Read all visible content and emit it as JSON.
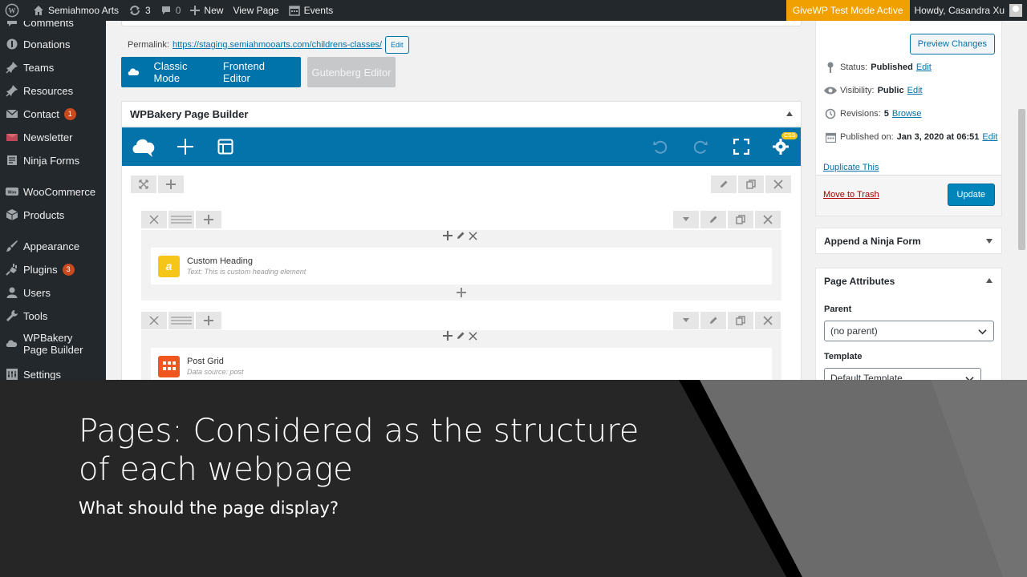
{
  "adminbar": {
    "site_name": "Semiahmoo Arts",
    "updates_count": "3",
    "comments_count": "0",
    "new_label": "New",
    "view_page_label": "View Page",
    "events_label": "Events",
    "givewp_label": "GiveWP Test Mode Active",
    "howdy_label": "Howdy, Casandra Xu"
  },
  "sidebar": {
    "items": [
      {
        "label": "Comments",
        "icon": "comment-icon"
      },
      {
        "label": "Donations",
        "icon": "donations-icon"
      },
      {
        "label": "Teams",
        "icon": "pin-icon"
      },
      {
        "label": "Resources",
        "icon": "pin-icon"
      },
      {
        "label": "Contact",
        "icon": "mail-icon",
        "badge": "1"
      },
      {
        "label": "Newsletter",
        "icon": "newsletter-icon"
      },
      {
        "label": "Ninja Forms",
        "icon": "forms-icon"
      },
      {
        "label": "WooCommerce",
        "icon": "woo-icon"
      },
      {
        "label": "Products",
        "icon": "products-icon"
      },
      {
        "label": "Appearance",
        "icon": "brush-icon"
      },
      {
        "label": "Plugins",
        "icon": "plugin-icon",
        "badge": "3"
      },
      {
        "label": "Users",
        "icon": "user-icon"
      },
      {
        "label": "Tools",
        "icon": "wrench-icon"
      },
      {
        "label": "WPBakery Page Builder",
        "icon": "wpbakery-icon"
      },
      {
        "label": "Settings",
        "icon": "settings-icon"
      }
    ]
  },
  "editor": {
    "permalink_label": "Permalink:",
    "permalink_url": "https://staging.semiahmooarts.com/childrens-classes/",
    "permalink_edit": "Edit",
    "classic_mode_label": "Classic Mode",
    "frontend_editor_label": "Frontend Editor",
    "gutenberg_label": "Gutenberg Editor",
    "wpb_title": "WPBakery Page Builder",
    "css_badge": "CSS",
    "elements": [
      {
        "name": "Custom Heading",
        "sub": "Text: This is custom heading element",
        "icon_glyph": "a",
        "color": "#f5c518"
      },
      {
        "name": "Post Grid",
        "sub": "Data source: post",
        "icon_glyph": "",
        "color": "#f0571f"
      }
    ]
  },
  "publish": {
    "preview_label": "Preview Changes",
    "status_label": "Status:",
    "status_value": "Published",
    "visibility_label": "Visibility:",
    "visibility_value": "Public",
    "revisions_label": "Revisions:",
    "revisions_value": "5",
    "browse_label": "Browse",
    "published_on_label": "Published on:",
    "published_on_value": "Jan 3, 2020 at 06:51",
    "edit_label": "Edit",
    "duplicate_label": "Duplicate This",
    "trash_label": "Move to Trash",
    "update_label": "Update"
  },
  "ninja": {
    "title": "Append a Ninja Form"
  },
  "page_attributes": {
    "title": "Page Attributes",
    "parent_label": "Parent",
    "parent_value": "(no parent)",
    "template_label": "Template",
    "template_value": "Default Template"
  },
  "slide": {
    "title": "Pages: Considered as the structure of each webpage",
    "subtitle": "What should the page display?"
  },
  "colors": {
    "wp_dark": "#23282d",
    "wp_blue": "#0073aa",
    "givewp_orange": "#f0a000",
    "slide_bg": "#262626"
  }
}
